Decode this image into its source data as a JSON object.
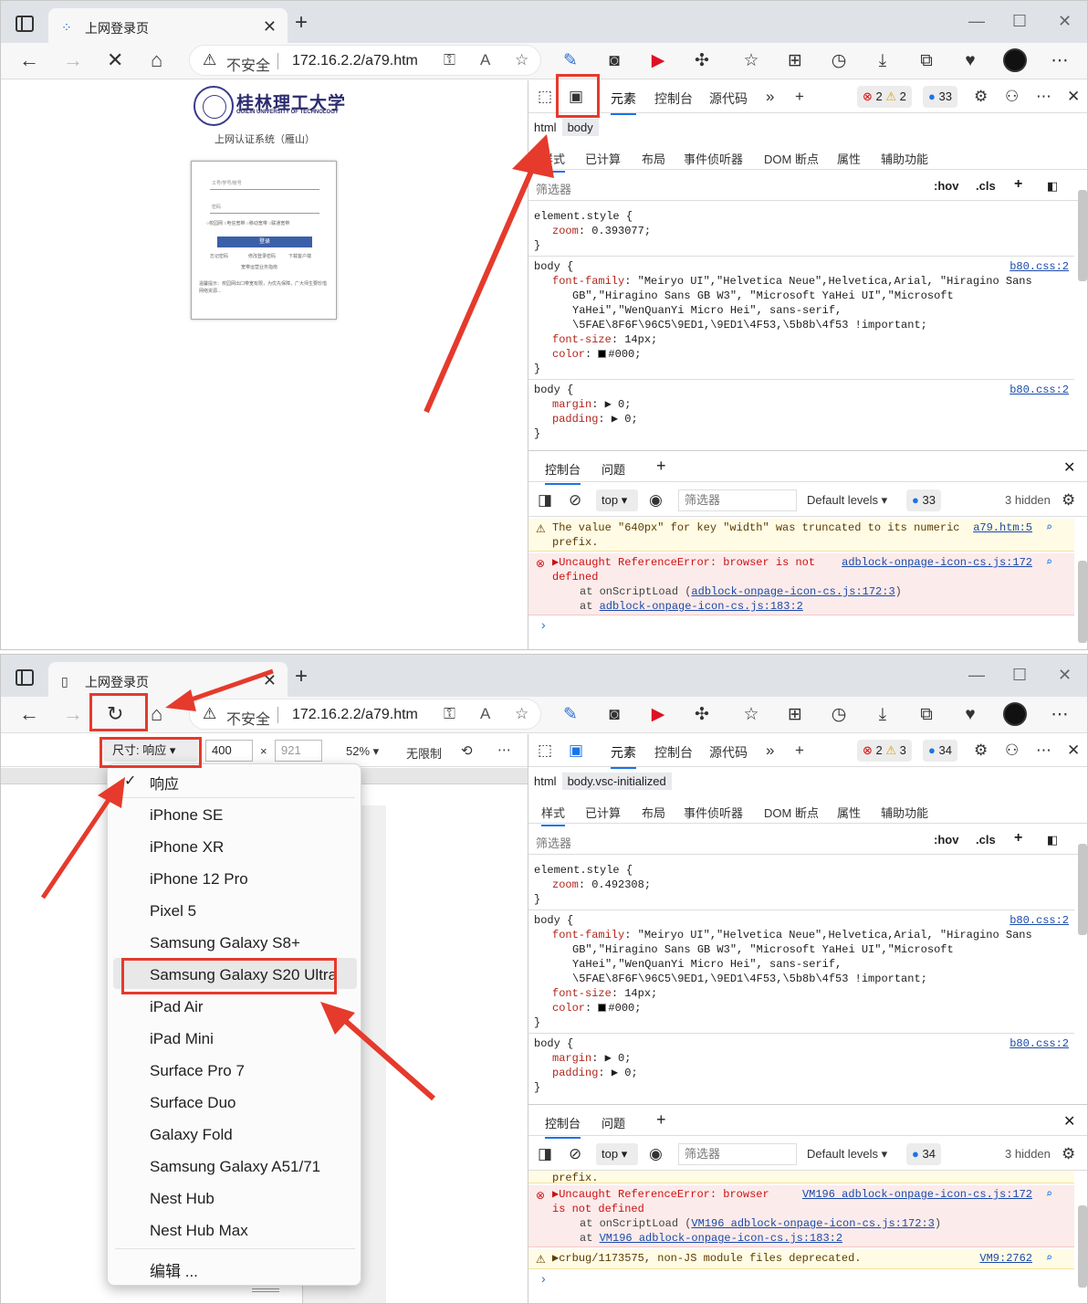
{
  "browser": {
    "tab_title": "上网登录页",
    "address": {
      "security_label": "不安全",
      "url": "172.16.2.2/a79.htm"
    }
  },
  "login_page": {
    "university_name": "桂林理工大学",
    "university_name_en": "GUILIN UNIVERSITY OF TECHNOLOGY",
    "system_name": "上网认证系统（雁山）",
    "username_placeholder": "工号/学号/账号",
    "password_placeholder": "密码",
    "radio_options": "○校园网  ○电信宽带  ○移动宽带  ○联通宽带",
    "login_button": "登录",
    "links": [
      "忘记密码",
      "修改登录密码",
      "下载客户端"
    ],
    "link2": "宽带运营业务指南",
    "notice": "温馨提示：校园网出口带宽有限，为优先保障，广大师生要珍惜网络资源..."
  },
  "devtools": {
    "tabs": [
      "元素",
      "控制台",
      "源代码"
    ],
    "shot1": {
      "errors": "2",
      "warnings": "2",
      "messages": "33",
      "crumb2": "body",
      "zoom": "0.393077;"
    },
    "shot2": {
      "errors": "2",
      "warnings": "3",
      "messages": "34",
      "crumb2": "body.vsc-initialized",
      "zoom": "0.492308;"
    },
    "crumb1": "html",
    "subtabs": [
      "样式",
      "已计算",
      "布局",
      "事件侦听器",
      "DOM 断点",
      "属性",
      "辅助功能"
    ],
    "filter_placeholder": "筛选器",
    "hov": ":hov",
    "cls": ".cls",
    "css": {
      "element_style": "element.style {",
      "zoom_key": "zoom",
      "close": "}",
      "body_sel": "body {",
      "source": "b80.css:2",
      "ff_key": "font-family",
      "ff_1": "\"Meiryo UI\",\"Helvetica Neue\",Helvetica,Arial, \"Hiragino Sans",
      "ff_2": "GB\",\"Hiragino Sans GB W3\", \"Microsoft YaHei UI\",\"Microsoft",
      "ff_3": "YaHei\",\"WenQuanYi Micro Hei\", sans-serif,",
      "ff_4": "\\5FAE\\8F6F\\96C5\\9ED1,\\9ED1\\4F53,\\5b8b\\4f53 !important;",
      "fs_key": "font-size",
      "fs_val": "14px;",
      "color_key": "color",
      "color_val": "#000;",
      "margin_key": "margin",
      "padding_key": "padding",
      "zero": "0;"
    },
    "console": {
      "tabs": [
        "控制台",
        "问题"
      ],
      "top": "top",
      "filter": "筛选器",
      "levels": "Default levels",
      "hidden": "3 hidden",
      "shot1_count": "33",
      "shot2_count": "34",
      "warn1_a": "The value \"640px\" for key \"width\" was truncated to its numeric",
      "warn1_b": "prefix.",
      "warn1_link": "a79.htm:5",
      "err_a": "Uncaught ReferenceError: browser is not",
      "err_b": "defined",
      "err_link": "adblock-onpage-icon-cs.js:172",
      "err_at1_pre": "at onScriptLoad (",
      "err_at1_link": "adblock-onpage-icon-cs.js:172:3",
      "err_at1_post": ")",
      "err_at2_pre": "at ",
      "err_at2_link": "adblock-onpage-icon-cs.js:183:2",
      "s2_prefix": "prefix.",
      "s2_err_a": "Uncaught ReferenceError: browser",
      "s2_err_b": "is not defined",
      "s2_err_link": "VM196 adblock-onpage-icon-cs.js:172",
      "s2_at1_link": "VM196 adblock-onpage-icon-cs.js:172:3",
      "s2_at2_link": "VM196 adblock-onpage-icon-cs.js:183:2",
      "s2_warn": "crbug/1173575, non-JS module files deprecated.",
      "s2_warn_link": "VM9:2762"
    }
  },
  "device_toolbar": {
    "size_label": "尺寸: 响应",
    "width": "400",
    "height": "921",
    "times": "×",
    "zoom": "52%",
    "throttle": "无限制",
    "menu": {
      "checked_item": "响应",
      "items": [
        "iPhone SE",
        "iPhone XR",
        "iPhone 12 Pro",
        "Pixel 5",
        "Samsung Galaxy S8+",
        "Samsung Galaxy S20 Ultra",
        "iPad Air",
        "iPad Mini",
        "Surface Pro 7",
        "Surface Duo",
        "Galaxy Fold",
        "Samsung Galaxy A51/71",
        "Nest Hub",
        "Nest Hub Max"
      ],
      "edit": "编辑 ..."
    }
  },
  "colors": {
    "highlight": "#e53a2c",
    "accent": "#1a73e8"
  }
}
